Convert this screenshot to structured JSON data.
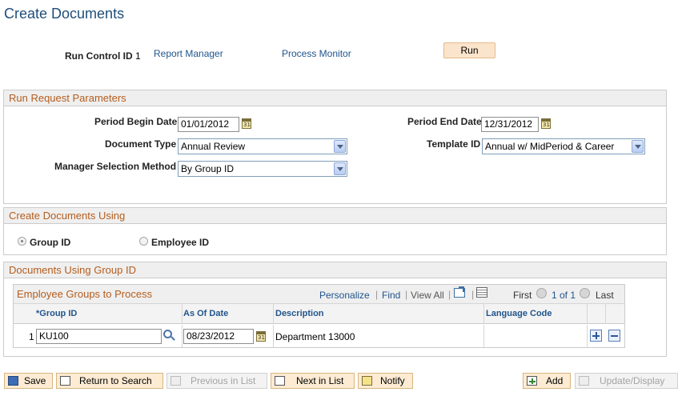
{
  "page": {
    "title": "Create Documents"
  },
  "run_control": {
    "label": "Run Control ID",
    "value": "1",
    "report_manager": "Report Manager",
    "process_monitor": "Process Monitor",
    "run_button": "Run"
  },
  "run_request": {
    "header": "Run Request Parameters",
    "period_begin_label": "Period Begin Date",
    "period_begin_value": "01/01/2012",
    "period_end_label": "Period End Date",
    "period_end_value": "12/31/2012",
    "document_type_label": "Document Type",
    "document_type_value": "Annual Review",
    "template_id_label": "Template ID",
    "template_id_value": "Annual w/ MidPeriod & Career",
    "manager_method_label": "Manager Selection Method",
    "manager_method_value": "By Group ID"
  },
  "create_using": {
    "header": "Create Documents Using",
    "option_group": "Group ID",
    "option_employee": "Employee ID",
    "selected": "Group ID"
  },
  "group_section": {
    "header": "Documents Using Group ID",
    "grid_title": "Employee Groups to Process",
    "personalize": "Personalize",
    "find": "Find",
    "view_all": "View All",
    "first": "First",
    "range": "1 of 1",
    "last": "Last",
    "columns": [
      "*Group ID",
      "As Of Date",
      "Description",
      "Language Code"
    ],
    "rows": [
      {
        "num": "1",
        "group_id": "KU100",
        "as_of_date": "08/23/2012",
        "description": "Department 13000",
        "language_code": ""
      }
    ]
  },
  "toolbar": {
    "save": "Save",
    "return_to_search": "Return to Search",
    "previous_in_list": "Previous in List",
    "next_in_list": "Next in List",
    "notify": "Notify",
    "add": "Add",
    "update_display": "Update/Display"
  },
  "colors": {
    "title": "#1f4e79",
    "link": "#21558c",
    "section_header": "#b45d1d",
    "button_bg": "#fbe4cc"
  }
}
